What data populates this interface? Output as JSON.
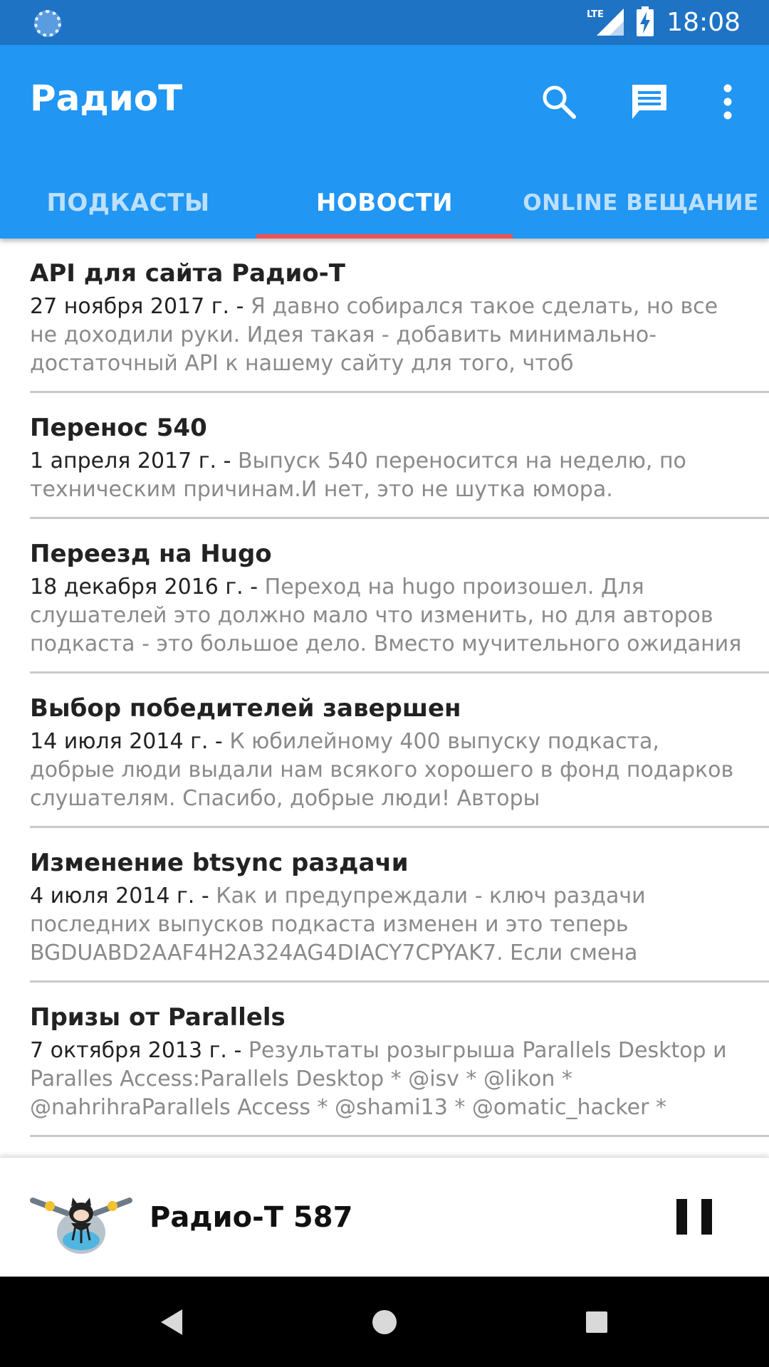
{
  "status_bar": {
    "network": "LTE",
    "time": "18:08"
  },
  "app_bar": {
    "title": "РадиоТ",
    "actions": [
      "search-icon",
      "chat-icon",
      "more-vert-icon"
    ]
  },
  "tabs": [
    {
      "label": "ПОДКАСТЫ",
      "active": false
    },
    {
      "label": "НОВОСТИ",
      "active": true
    },
    {
      "label": "ONLINE ВЕЩАНИЕ",
      "active": false
    }
  ],
  "news": [
    {
      "title": "API для сайта Радио-Т",
      "date": "27 ноября 2017 г. -",
      "excerpt": "Я давно собирался такое сделать, но все не доходили руки. Идея такая - добавить минимально-достаточный API к нашему сайту для того, чтоб"
    },
    {
      "title": "Перенос 540",
      "date": "1 апреля 2017 г. -",
      "excerpt": "Выпуск 540 переносится на неделю, по техническим причинам.И нет, это не шутка юмора."
    },
    {
      "title": "Переезд на Hugo",
      "date": "18 декабря 2016 г. -",
      "excerpt": "Переход на hugo произошел. Для слушателей это должно мало что изменить, но для авторов подкаста - это большое дело. Вместо мучительного ожидания"
    },
    {
      "title": "Выбор победителей завершен",
      "date": "14 июля 2014 г. -",
      "excerpt": "К юбилейному 400 выпуску подкаста, добрые люди выдали нам всякого хорошего в фонд подарков слушателям. Спасибо, добрые люди! Авторы"
    },
    {
      "title": "Изменение btsync раздачи",
      "date": "4 июля 2014 г. -",
      "excerpt": "Как и предупреждали - ключ раздачи последних выпусков подкаста изменен и это теперь BGDUABD2AAF4H2A324AG4DIACY7CPYAK7. Если смена"
    },
    {
      "title": "Призы от Parallels",
      "date": "7 октября 2013 г. -",
      "excerpt": "Результаты розыгрыша Parallels Desktop и Paralles Access:Parallels Desktop * @isv * @likon * @nahrihraParallels Access * @shami13 * @omatic_hacker *"
    }
  ],
  "player": {
    "title": "Радио-Т 587",
    "state": "playing"
  },
  "colors": {
    "status_bar": "#1e73c5",
    "primary": "#2196f3",
    "tab_indicator": "#ef5350"
  }
}
